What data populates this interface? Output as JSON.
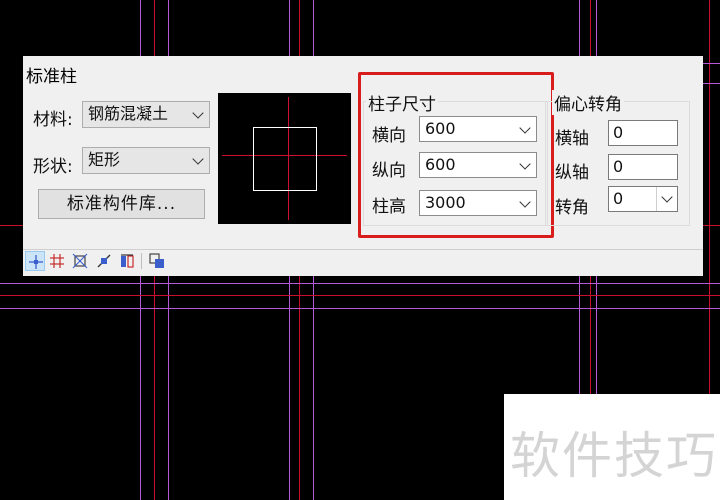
{
  "dialog": {
    "title": "标准柱",
    "material": {
      "label": "材料:",
      "value": "钢筋混凝土"
    },
    "shape": {
      "label": "形状:",
      "value": "矩形"
    },
    "library_button": "标准构件库...",
    "size": {
      "caption": "柱子尺寸",
      "horizontal": {
        "label": "横向",
        "value": "600"
      },
      "vertical": {
        "label": "纵向",
        "value": "600"
      },
      "height": {
        "label": "柱高",
        "value": "3000"
      }
    },
    "offset": {
      "caption": "偏心转角",
      "x_axis": {
        "label": "横轴",
        "value": "0"
      },
      "y_axis": {
        "label": "纵轴",
        "value": "0"
      },
      "rotation": {
        "label": "转角",
        "value": "0"
      }
    },
    "toolbar_icons": [
      "point-insert-icon",
      "grid-insert-icon",
      "axis-insert-icon",
      "region-insert-icon",
      "replace-icon",
      "pick-icon"
    ]
  },
  "watermark": "软件技巧",
  "colors": {
    "highlight": "#d91c1c",
    "cad_red": "#c8102e",
    "cad_magenta": "#b45ad8",
    "dialog_bg": "#f0f0f0"
  }
}
